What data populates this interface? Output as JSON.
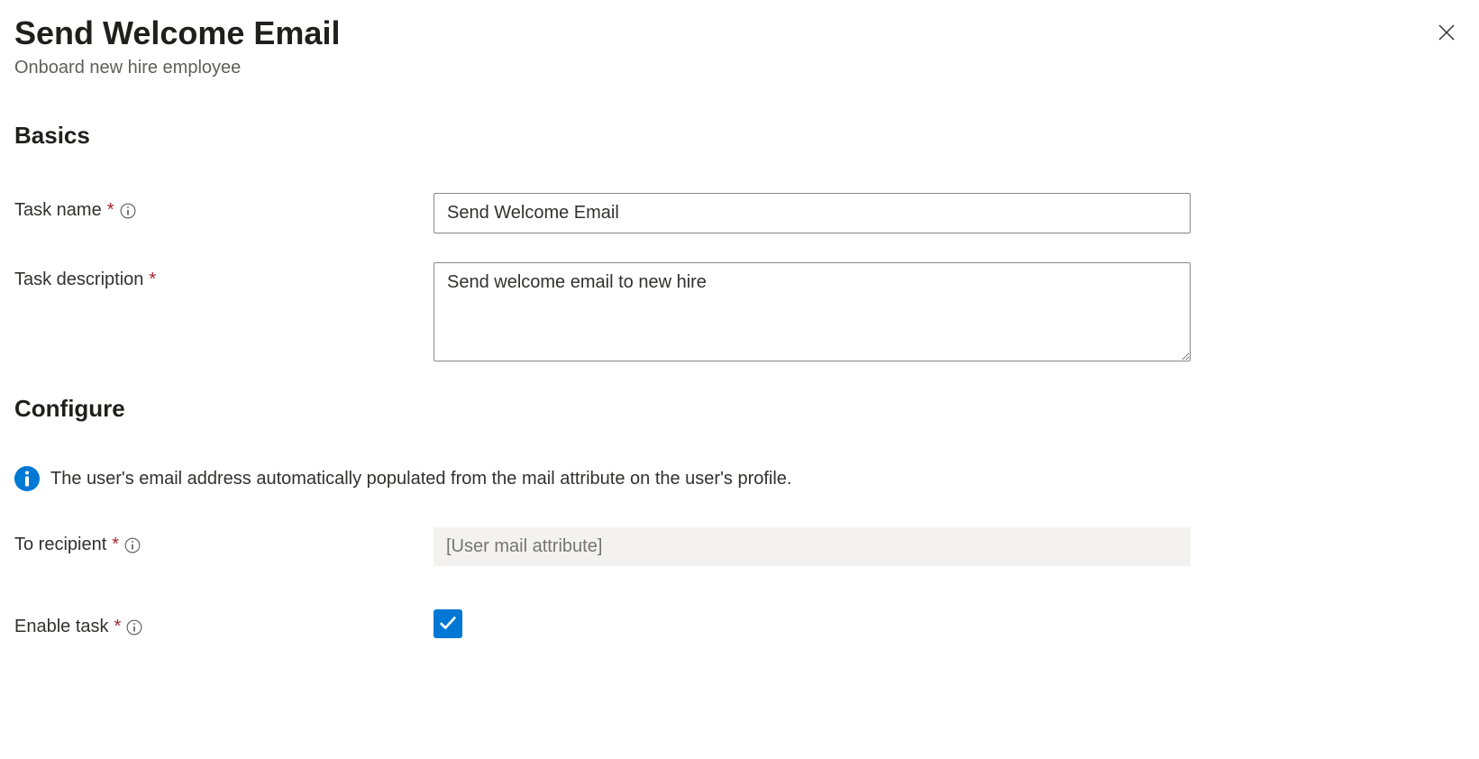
{
  "header": {
    "title": "Send Welcome Email",
    "subtitle": "Onboard new hire employee"
  },
  "sections": {
    "basics": {
      "title": "Basics",
      "task_name_label": "Task name",
      "task_name_value": "Send Welcome Email",
      "task_description_label": "Task description",
      "task_description_value": "Send welcome email to new hire"
    },
    "configure": {
      "title": "Configure",
      "info_text": "The user's email address automatically populated from the mail attribute on the user's profile.",
      "to_recipient_label": "To recipient",
      "to_recipient_placeholder": "[User mail attribute]",
      "enable_task_label": "Enable task",
      "enable_task_checked": true
    }
  }
}
